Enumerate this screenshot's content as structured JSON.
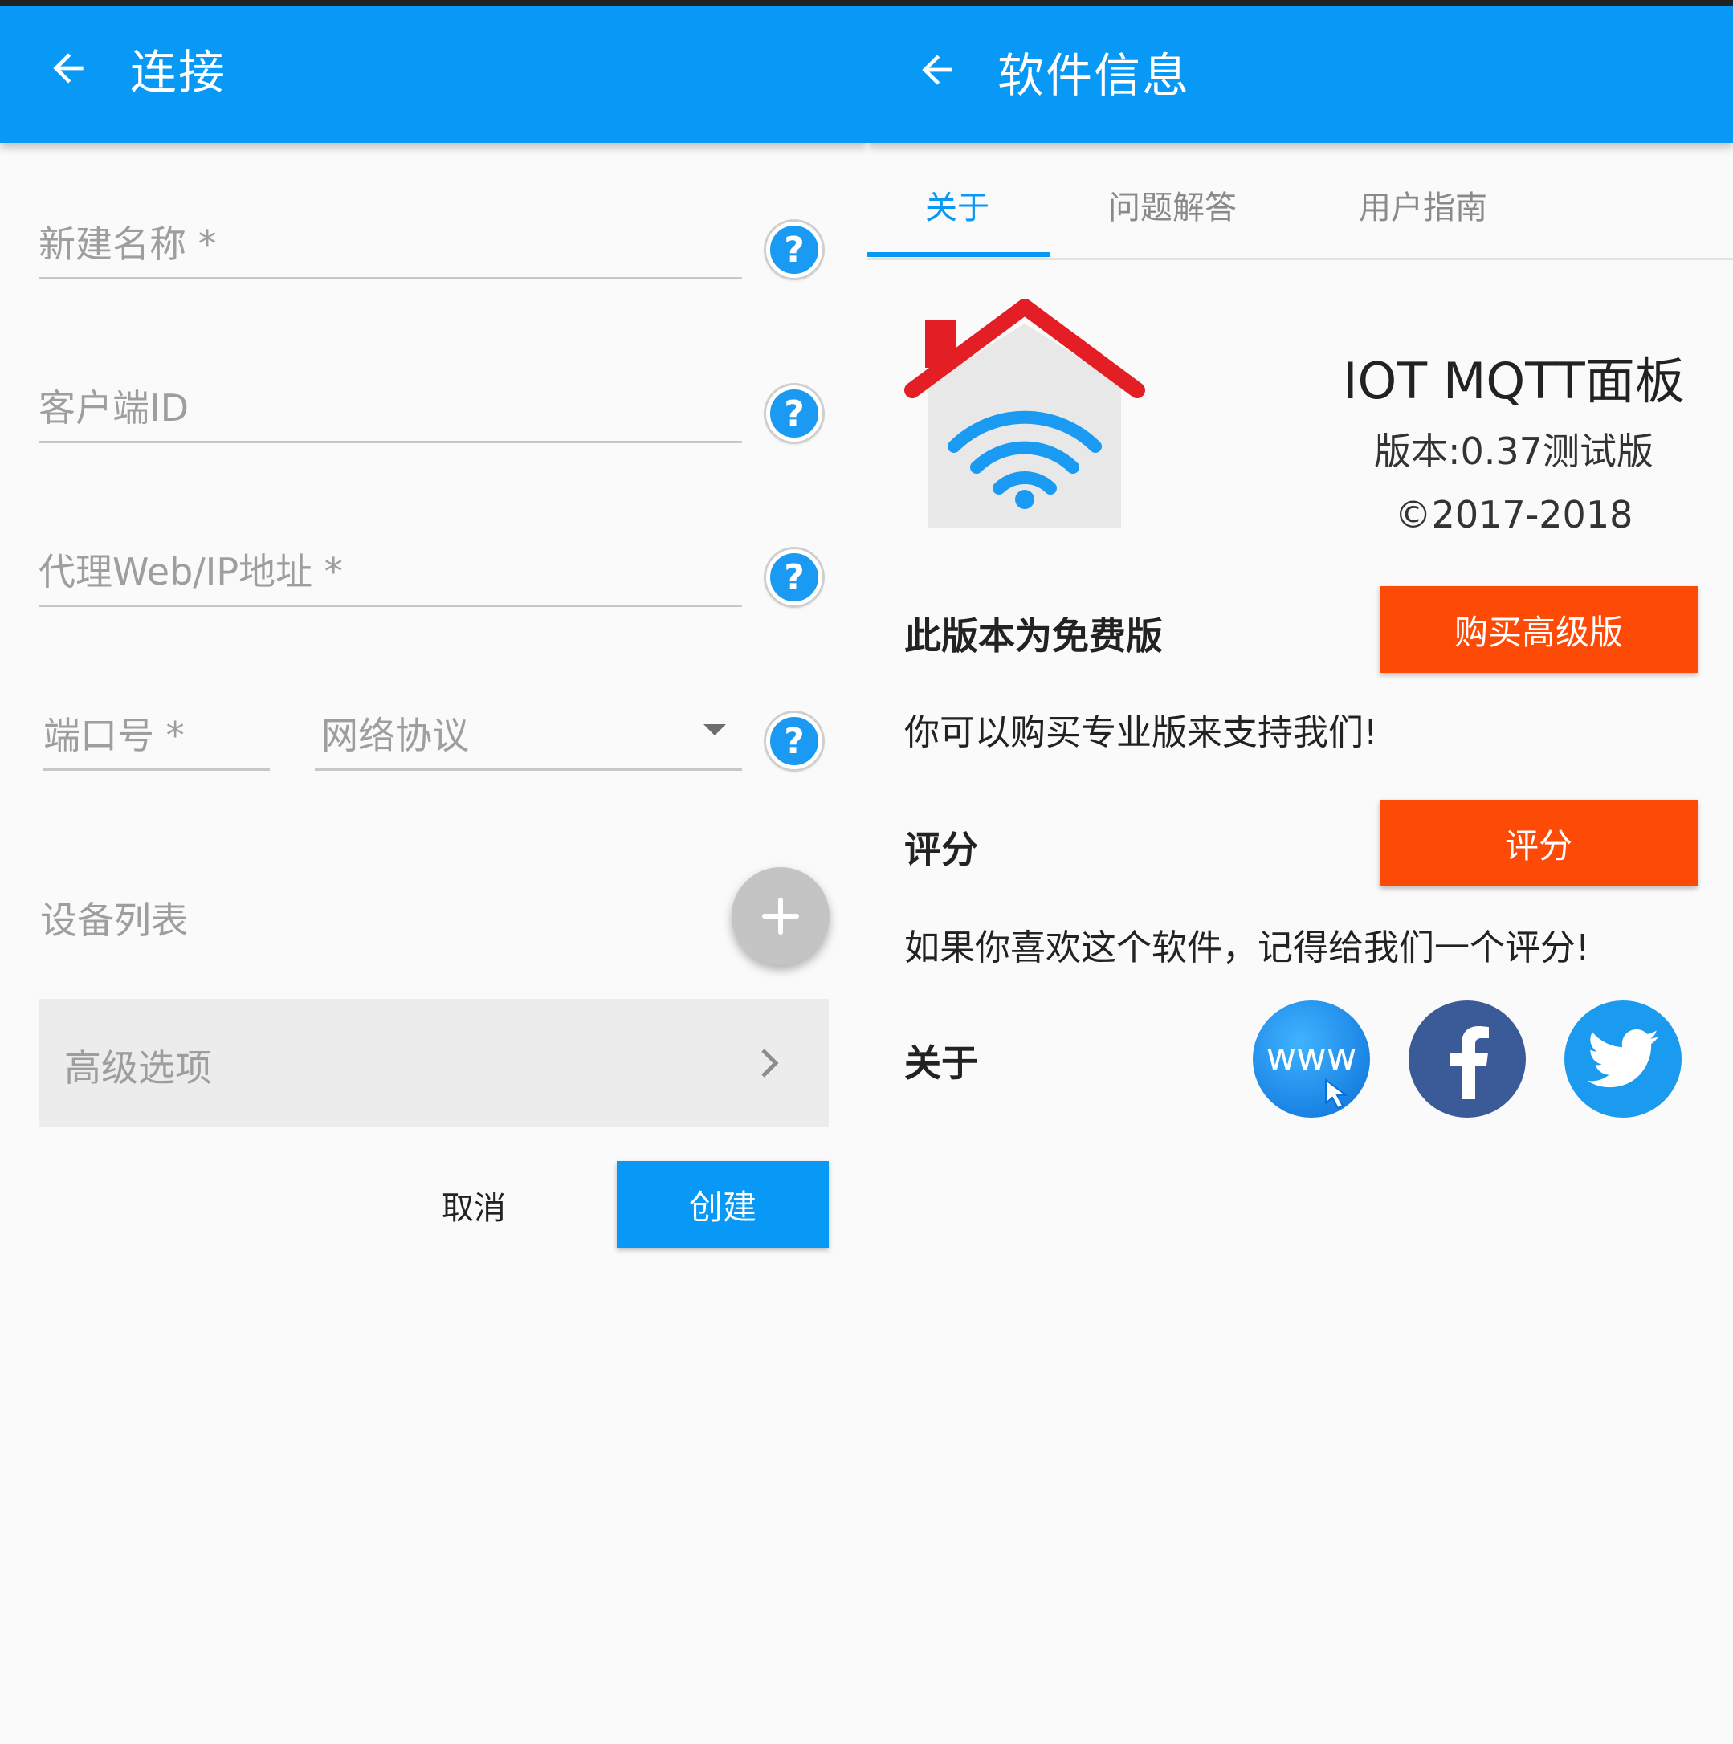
{
  "connect_screen": {
    "title": "连接",
    "fields": {
      "name_label": "新建名称 *",
      "client_id_label": "客户端ID",
      "broker_label": "代理Web/IP地址 *",
      "port_label": "端口号 *",
      "protocol_label": "网络协议"
    },
    "help_glyph": "?",
    "device_list_label": "设备列表",
    "advanced_label": "高级选项",
    "cancel_label": "取消",
    "create_label": "创建"
  },
  "info_screen": {
    "title": "软件信息",
    "tabs": [
      {
        "label": "关于",
        "active": true
      },
      {
        "label": "问题解答",
        "active": false
      },
      {
        "label": "用户指南",
        "active": false
      }
    ],
    "app_name": "IOT MQTT面板",
    "version": "版本:0.37测试版",
    "copyright": "©2017-2018",
    "free_title": "此版本为免费版",
    "buy_button": "购买高级版",
    "buy_text": "你可以购买专业版来支持我们!",
    "rate_title": "评分",
    "rate_button": "评分",
    "rate_text": "如果你喜欢这个软件，记得给我们一个评分!",
    "about_title": "关于",
    "www_label": "www"
  },
  "icons": [
    "back-arrow-icon",
    "help-icon",
    "dropdown-arrow-icon",
    "plus-icon",
    "chevron-right-icon",
    "house-wifi-logo-icon",
    "www-icon",
    "facebook-icon",
    "twitter-icon"
  ],
  "colors": {
    "primary": "#0898f5",
    "accent_orange": "#fd4a06",
    "facebook": "#3b5a98",
    "twitter": "#1b9bf0",
    "logo_roof": "#e31e24"
  }
}
